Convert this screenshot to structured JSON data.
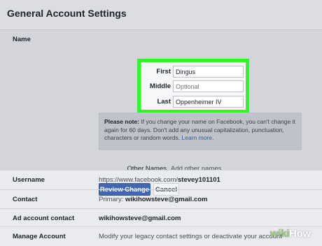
{
  "header": {
    "title": "General Account Settings"
  },
  "name_section": {
    "label": "Name",
    "fields": [
      {
        "label": "First",
        "value": "Dingus"
      },
      {
        "label": "Middle",
        "placeholder": "Optional"
      },
      {
        "label": "Last",
        "value": "Oppenheimer IV"
      }
    ],
    "highlight_color": "#2ef82a",
    "note": {
      "bold": "Please note:",
      "text": " If you change your name on Facebook, you can't change it again for 60 days. Don't add any unusual capitalization, punctuation, characters or random words. ",
      "link": "Learn more."
    },
    "other_names_label": "Other Names",
    "other_names_link": "Add other names",
    "review_button": "Review Change",
    "cancel_button": "Cancel"
  },
  "rows": [
    {
      "label": "Username",
      "value": "https://www.facebook.com/",
      "value_bold": "stevey101101"
    },
    {
      "label": "Contact",
      "value": "Primary: ",
      "value_bold": "wikihowsteve@gmail.com"
    },
    {
      "label": "Ad account contact",
      "value_bold": "wikihowsteve@gmail.com"
    },
    {
      "label": "Manage Account",
      "value": "Modify your legacy contact settings or deactivate your account"
    }
  ],
  "watermark": {
    "wiki": "wiki",
    "how": "How"
  },
  "colors": {
    "primary_button": "#4267b2",
    "link": "#385898"
  }
}
